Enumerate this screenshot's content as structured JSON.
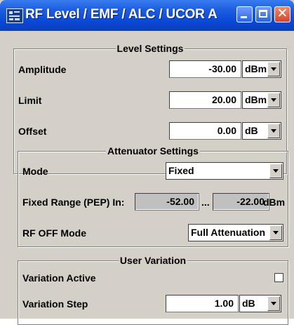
{
  "window": {
    "title": "RF Level / EMF / ALC / UCOR A"
  },
  "level_settings": {
    "title": "Level Settings",
    "amplitude": {
      "label": "Amplitude",
      "value": "-30.00",
      "unit": "dBm"
    },
    "limit": {
      "label": "Limit",
      "value": "20.00",
      "unit": "dBm"
    },
    "offset": {
      "label": "Offset",
      "value": "0.00",
      "unit": "dB"
    }
  },
  "attenuator_settings": {
    "title": "Attenuator Settings",
    "mode": {
      "label": "Mode",
      "value": "Fixed"
    },
    "fixed_range": {
      "label": "Fixed Range (PEP) In:",
      "min": "-52.00",
      "separator": "...",
      "max": "-22.00",
      "unit": "dBm"
    },
    "rf_off_mode": {
      "label": "RF OFF Mode",
      "value": "Full Attenuation"
    }
  },
  "user_variation": {
    "title": "User Variation",
    "variation_active": {
      "label": "Variation Active",
      "checked": false
    },
    "variation_step": {
      "label": "Variation Step",
      "value": "1.00",
      "unit": "dB"
    }
  }
}
